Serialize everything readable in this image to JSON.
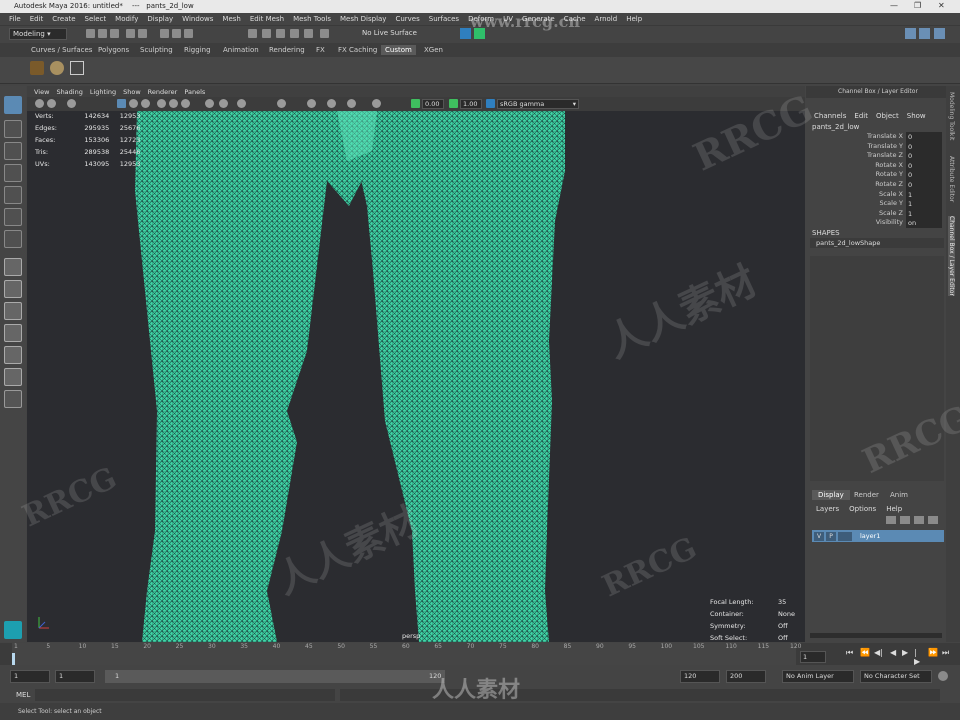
{
  "window": {
    "title": "Autodesk Maya 2016: untitled*",
    "separator": "---",
    "object": "pants_2d_low"
  },
  "menubar": [
    "File",
    "Edit",
    "Create",
    "Select",
    "Modify",
    "Display",
    "Windows",
    "Mesh",
    "Edit Mesh",
    "Mesh Tools",
    "Mesh Display",
    "Curves",
    "Surfaces",
    "Deform",
    "UV",
    "Generate",
    "Cache",
    "Arnold",
    "Help"
  ],
  "statusline": {
    "mode": "Modeling",
    "live_surface": "No Live Surface"
  },
  "shelf_tabs": [
    "Curves / Surfaces",
    "Polygons",
    "Sculpting",
    "Rigging",
    "Animation",
    "Rendering",
    "FX",
    "FX Caching",
    "Custom",
    "XGen"
  ],
  "shelf_active": "Custom",
  "viewport": {
    "menu": [
      "View",
      "Shading",
      "Lighting",
      "Show",
      "Renderer",
      "Panels"
    ],
    "exposure": "0.00",
    "gamma": "1.00",
    "colorspace": "sRGB gamma",
    "hud": [
      {
        "label": "Verts:",
        "v1": "142634",
        "v2": "12953"
      },
      {
        "label": "Edges:",
        "v1": "295935",
        "v2": "25676"
      },
      {
        "label": "Faces:",
        "v1": "153306",
        "v2": "12723"
      },
      {
        "label": "Tris:",
        "v1": "289538",
        "v2": "25446"
      },
      {
        "label": "UVs:",
        "v1": "143095",
        "v2": "12953"
      }
    ],
    "hud_right": [
      {
        "label": "Focal Length:",
        "value": "35"
      },
      {
        "label": "Container:",
        "value": "None"
      },
      {
        "label": "Symmetry:",
        "value": "Off"
      },
      {
        "label": "Soft Select:",
        "value": "Off"
      }
    ],
    "camera": "persp",
    "mesh_color": "#3fd9a8"
  },
  "channelbox": {
    "header": "Channel Box / Layer Editor",
    "menu": [
      "Channels",
      "Edit",
      "Object",
      "Show"
    ],
    "object": "pants_2d_low",
    "attributes": [
      {
        "name": "Translate X",
        "value": "0"
      },
      {
        "name": "Translate Y",
        "value": "0"
      },
      {
        "name": "Translate Z",
        "value": "0"
      },
      {
        "name": "Rotate X",
        "value": "0"
      },
      {
        "name": "Rotate Y",
        "value": "0"
      },
      {
        "name": "Rotate Z",
        "value": "0"
      },
      {
        "name": "Scale X",
        "value": "1"
      },
      {
        "name": "Scale Y",
        "value": "1"
      },
      {
        "name": "Scale Z",
        "value": "1"
      },
      {
        "name": "Visibility",
        "value": "on"
      }
    ],
    "shapes_label": "SHAPES",
    "shape": "pants_2d_lowShape"
  },
  "side_tabs": [
    "Modeling Toolkit",
    "Attribute Editor",
    "Channel Box / Layer Editor"
  ],
  "layer_editor": {
    "tabs": [
      "Display",
      "Render",
      "Anim"
    ],
    "menu": [
      "Layers",
      "Options",
      "Help"
    ],
    "layer": {
      "v": "V",
      "p": "P",
      "name": "layer1"
    }
  },
  "timeline": {
    "ticks": [
      "1",
      "5",
      "10",
      "15",
      "20",
      "25",
      "30",
      "35",
      "40",
      "45",
      "50",
      "55",
      "60",
      "65",
      "70",
      "75",
      "80",
      "85",
      "90",
      "95",
      "100",
      "105",
      "110",
      "115",
      "120"
    ],
    "current_frame": "1"
  },
  "range": {
    "start": "1",
    "start2": "1",
    "slider_start": "1",
    "slider_end": "120",
    "end": "120",
    "end2": "200",
    "anim_layer": "No Anim Layer",
    "char_set": "No Character Set"
  },
  "mel_label": "MEL",
  "help_line": "Select Tool: select an object",
  "watermarks": [
    "RRCG",
    "人人素材",
    "www.rrcg.cn"
  ]
}
